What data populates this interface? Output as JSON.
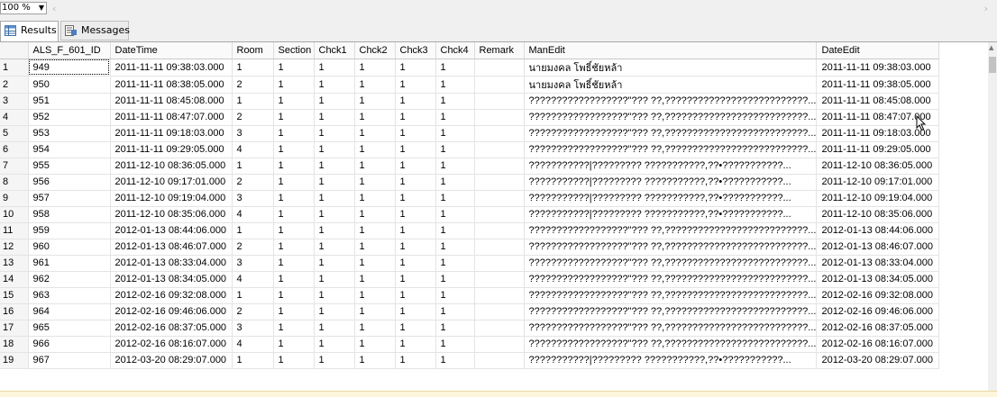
{
  "toolbar": {
    "zoom_value": "100 %"
  },
  "tabs": [
    {
      "label": "Results",
      "icon": "grid-icon"
    },
    {
      "label": "Messages",
      "icon": "messages-icon"
    }
  ],
  "grid": {
    "columns": [
      "",
      "ALS_F_601_ID",
      "DateTime",
      "Room",
      "Section",
      "Chck1",
      "Chck2",
      "Chck3",
      "Chck4",
      "Remark",
      "ManEdit",
      "DateEdit"
    ],
    "rows": [
      [
        "1",
        "949",
        "2011-11-11 09:38:03.000",
        "1",
        "1",
        "1",
        "1",
        "1",
        "1",
        "",
        "นายมงคล โพธิ์ชัยหล้า",
        "2011-11-11 09:38:03.000"
      ],
      [
        "2",
        "950",
        "2011-11-11 08:38:05.000",
        "2",
        "1",
        "1",
        "1",
        "1",
        "1",
        "",
        "นายมงคล โพธิ์ชัยหล้า",
        "2011-11-11 09:38:05.000"
      ],
      [
        "3",
        "951",
        "2011-11-11 08:45:08.000",
        "1",
        "1",
        "1",
        "1",
        "1",
        "1",
        "",
        "??????????????????\"??? ??,??????????????????????????...",
        "2011-11-11 08:45:08.000"
      ],
      [
        "4",
        "952",
        "2011-11-11 08:47:07.000",
        "2",
        "1",
        "1",
        "1",
        "1",
        "1",
        "",
        "??????????????????\"??? ??,??????????????????????????...",
        "2011-11-11 08:47:07.000"
      ],
      [
        "5",
        "953",
        "2011-11-11 09:18:03.000",
        "3",
        "1",
        "1",
        "1",
        "1",
        "1",
        "",
        "??????????????????\"??? ??,??????????????????????????...",
        "2011-11-11 09:18:03.000"
      ],
      [
        "6",
        "954",
        "2011-11-11 09:29:05.000",
        "4",
        "1",
        "1",
        "1",
        "1",
        "1",
        "",
        "??????????????????\"??? ??,??????????????????????????...",
        "2011-11-11 09:29:05.000"
      ],
      [
        "7",
        "955",
        "2011-12-10 08:36:05.000",
        "1",
        "1",
        "1",
        "1",
        "1",
        "1",
        "",
        "???????????|????????? ???????????,??•???????????...",
        "2011-12-10 08:36:05.000"
      ],
      [
        "8",
        "956",
        "2011-12-10 09:17:01.000",
        "2",
        "1",
        "1",
        "1",
        "1",
        "1",
        "",
        "???????????|????????? ???????????,??•???????????...",
        "2011-12-10 09:17:01.000"
      ],
      [
        "9",
        "957",
        "2011-12-10 09:19:04.000",
        "3",
        "1",
        "1",
        "1",
        "1",
        "1",
        "",
        "???????????|????????? ???????????,??•???????????...",
        "2011-12-10 09:19:04.000"
      ],
      [
        "10",
        "958",
        "2011-12-10 08:35:06.000",
        "4",
        "1",
        "1",
        "1",
        "1",
        "1",
        "",
        "???????????|????????? ???????????,??•???????????...",
        "2011-12-10 08:35:06.000"
      ],
      [
        "11",
        "959",
        "2012-01-13 08:44:06.000",
        "1",
        "1",
        "1",
        "1",
        "1",
        "1",
        "",
        "??????????????????\"??? ??,??????????????????????????...",
        "2012-01-13 08:44:06.000"
      ],
      [
        "12",
        "960",
        "2012-01-13 08:46:07.000",
        "2",
        "1",
        "1",
        "1",
        "1",
        "1",
        "",
        "??????????????????\"??? ??,??????????????????????????...",
        "2012-01-13 08:46:07.000"
      ],
      [
        "13",
        "961",
        "2012-01-13 08:33:04.000",
        "3",
        "1",
        "1",
        "1",
        "1",
        "1",
        "",
        "??????????????????\"??? ??,??????????????????????????...",
        "2012-01-13 08:33:04.000"
      ],
      [
        "14",
        "962",
        "2012-01-13 08:34:05.000",
        "4",
        "1",
        "1",
        "1",
        "1",
        "1",
        "",
        "??????????????????\"??? ??,??????????????????????????...",
        "2012-01-13 08:34:05.000"
      ],
      [
        "15",
        "963",
        "2012-02-16 09:32:08.000",
        "1",
        "1",
        "1",
        "1",
        "1",
        "1",
        "",
        "??????????????????\"??? ??,??????????????????????????...",
        "2012-02-16 09:32:08.000"
      ],
      [
        "16",
        "964",
        "2012-02-16 09:46:06.000",
        "2",
        "1",
        "1",
        "1",
        "1",
        "1",
        "",
        "??????????????????\"??? ??,??????????????????????????...",
        "2012-02-16 09:46:06.000"
      ],
      [
        "17",
        "965",
        "2012-02-16 08:37:05.000",
        "3",
        "1",
        "1",
        "1",
        "1",
        "1",
        "",
        "??????????????????\"??? ??,??????????????????????????...",
        "2012-02-16 08:37:05.000"
      ],
      [
        "18",
        "966",
        "2012-02-16 08:16:07.000",
        "4",
        "1",
        "1",
        "1",
        "1",
        "1",
        "",
        "??????????????????\"??? ??,??????????????????????????...",
        "2012-02-16 08:16:07.000"
      ],
      [
        "19",
        "967",
        "2012-03-20 08:29:07.000",
        "1",
        "1",
        "1",
        "1",
        "1",
        "1",
        "",
        "???????????|????????? ???????????,??•???????????...",
        "2012-03-20 08:29:07.000"
      ]
    ]
  }
}
